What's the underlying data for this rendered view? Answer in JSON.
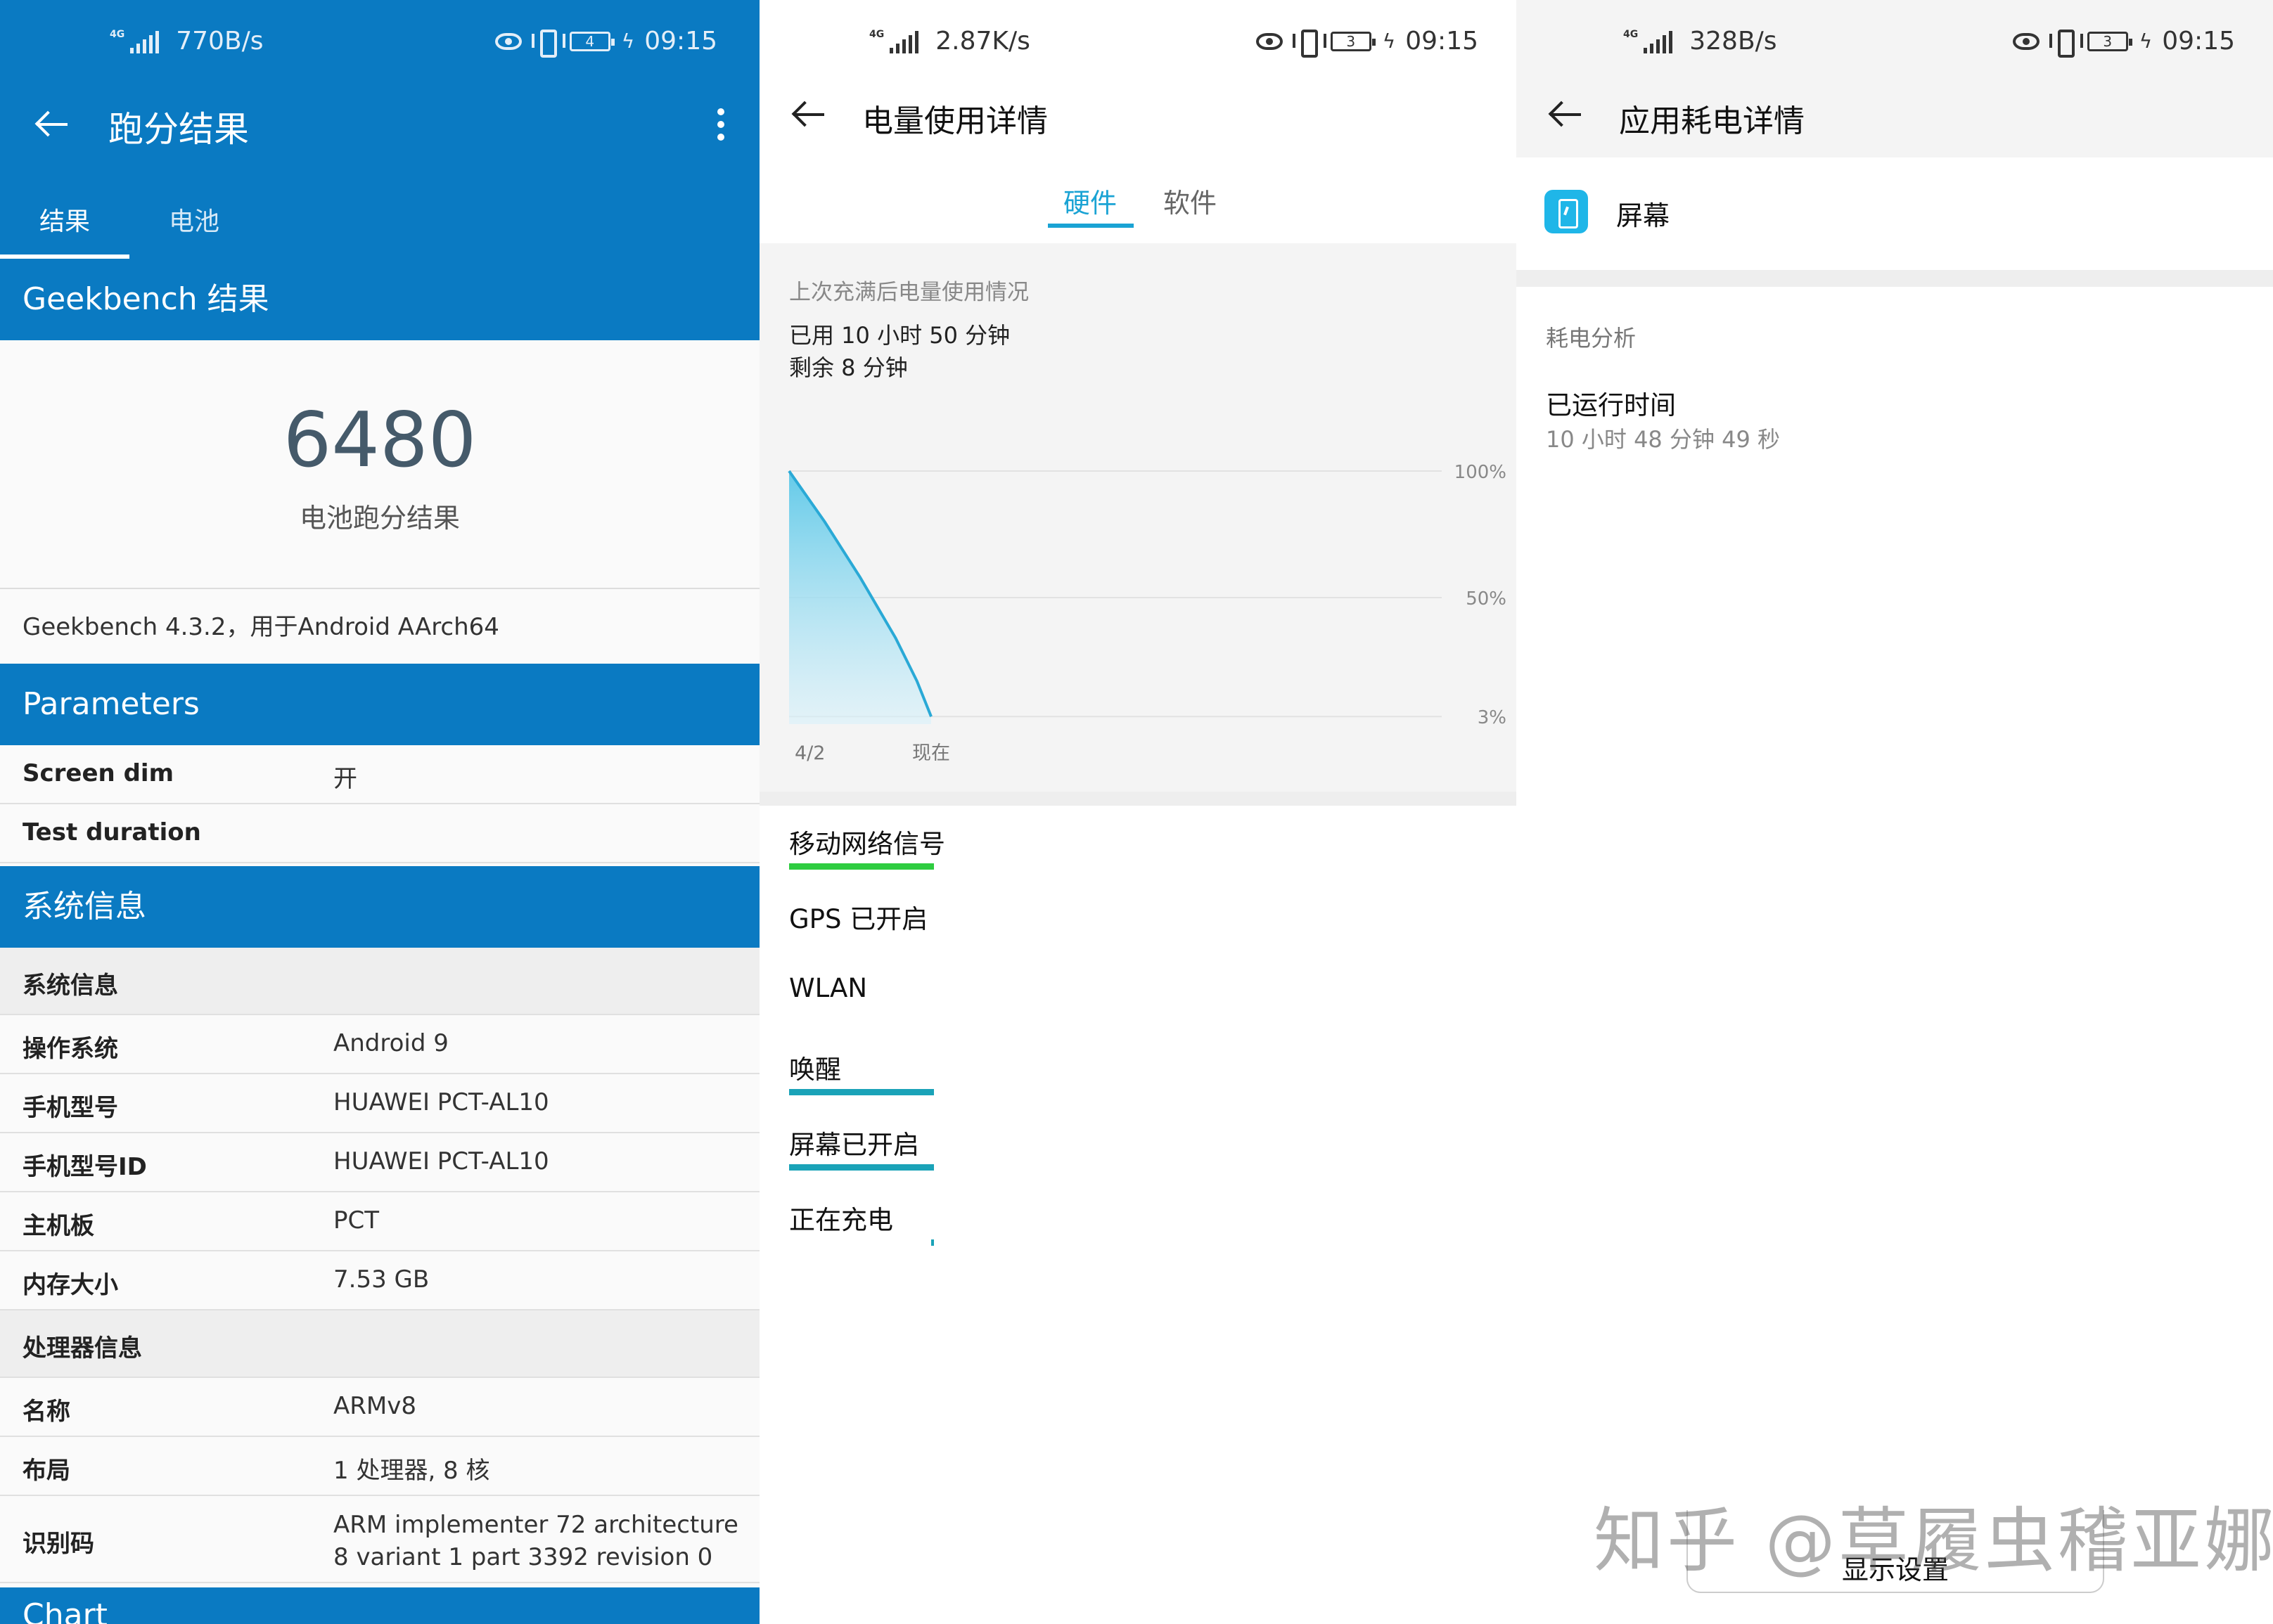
{
  "panel1": {
    "status": {
      "speed": "770B/s",
      "battery": "4",
      "time": "09:15"
    },
    "title": "跑分结果",
    "tabs": [
      "结果",
      "电池"
    ],
    "section_geekbench": "Geekbench 结果",
    "score": "6480",
    "score_label": "电池跑分结果",
    "version": "Geekbench 4.3.2，用于Android AArch64",
    "section_parameters": "Parameters",
    "params": [
      {
        "k": "Screen dim",
        "v": "开"
      },
      {
        "k": "Test duration",
        "v": ""
      }
    ],
    "section_system": "系统信息",
    "sys_subheader": "系统信息",
    "sys": [
      {
        "k": "操作系统",
        "v": "Android 9"
      },
      {
        "k": "手机型号",
        "v": "HUAWEI PCT-AL10"
      },
      {
        "k": "手机型号ID",
        "v": "HUAWEI PCT-AL10"
      },
      {
        "k": "主机板",
        "v": "PCT"
      },
      {
        "k": "内存大小",
        "v": "7.53 GB"
      }
    ],
    "cpu_subheader": "处理器信息",
    "cpu": [
      {
        "k": "名称",
        "v": "ARMv8"
      },
      {
        "k": "布局",
        "v": "1 处理器, 8 核"
      },
      {
        "k": "识别码",
        "v": "ARM implementer 72 architecture 8 variant 1 part 3392 revision 0"
      }
    ],
    "section_chart": "Chart",
    "accent": "#0a7ac2"
  },
  "panel2": {
    "status": {
      "speed": "2.87K/s",
      "battery": "3",
      "time": "09:15"
    },
    "title": "电量使用详情",
    "seg_tabs": [
      "硬件",
      "软件"
    ],
    "caption": "上次充满后电量使用情况",
    "used": "已用 10 小时 50 分钟",
    "remaining": "剩余 8 分钟",
    "chart_data": {
      "type": "area",
      "x_labels": [
        "4/2",
        "现在"
      ],
      "y_ticks": [
        "100%",
        "50%",
        "3%"
      ],
      "points": [
        [
          0,
          100
        ],
        [
          0.25,
          80
        ],
        [
          0.5,
          58
        ],
        [
          0.75,
          34
        ],
        [
          0.9,
          17
        ],
        [
          1,
          3
        ]
      ]
    },
    "hardware": [
      {
        "label": "移动网络信号",
        "bar_color": "#2ecc40",
        "bar_fraction": 1.0
      },
      {
        "label": "GPS 已开启",
        "bar_color": "",
        "bar_fraction": 0
      },
      {
        "label": "WLAN",
        "bar_color": "",
        "bar_fraction": 0
      },
      {
        "label": "唤醒",
        "bar_color": "#1aa3b8",
        "bar_fraction": 1.0
      },
      {
        "label": "屏幕已开启",
        "bar_color": "#1aa3b8",
        "bar_fraction": 1.0
      },
      {
        "label": "正在充电",
        "bar_color": "#1aa3b8",
        "bar_fraction": 0.02
      }
    ],
    "accent": "#1aa3d4"
  },
  "panel3": {
    "status": {
      "speed": "328B/s",
      "battery": "3",
      "time": "09:15"
    },
    "title": "应用耗电详情",
    "app_name": "屏幕",
    "section": "耗电分析",
    "run_label": "已运行时间",
    "run_value": "10 小时 48 分钟 49 秒",
    "button": "显示设置",
    "watermark": "知乎 @草履虫稽亚娜"
  }
}
